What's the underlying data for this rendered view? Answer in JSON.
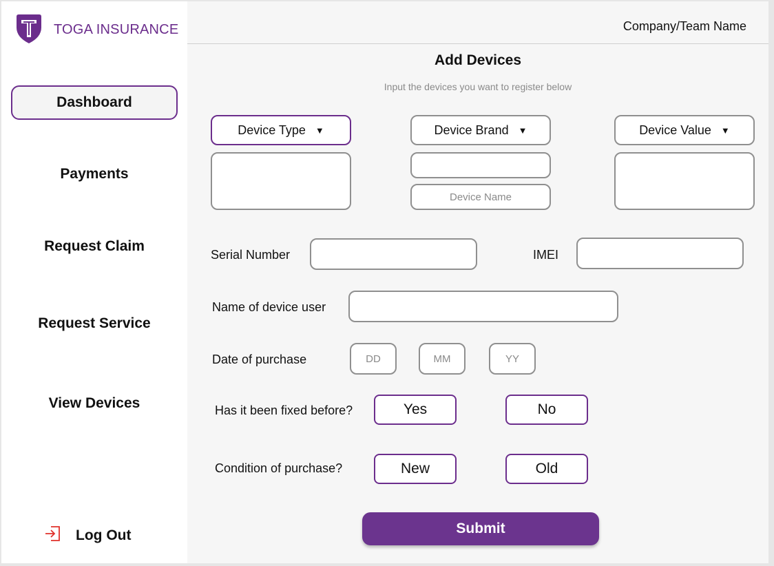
{
  "brand": {
    "name": "TOGA INSURANCE",
    "logo_letter": "T",
    "color": "#6b2d8c"
  },
  "sidebar": {
    "items": [
      {
        "label": "Dashboard",
        "active": true
      },
      {
        "label": "Payments"
      },
      {
        "label": "Request Claim"
      },
      {
        "label": "Request Service"
      },
      {
        "label": "View Devices"
      }
    ],
    "logout": {
      "label": "Log Out",
      "icon": "logout-icon"
    }
  },
  "header": {
    "team_name": "Company/Team Name"
  },
  "form": {
    "title": "Add Devices",
    "subtitle": "Input the devices you want to register below",
    "device_type": {
      "label": "Device Type",
      "caret": "▼"
    },
    "device_brand": {
      "label": "Device Brand",
      "caret": "▼"
    },
    "device_value": {
      "label": "Device Value",
      "caret": "▼"
    },
    "device_name_placeholder": "Device Name",
    "serial_label": "Serial Number",
    "imei_label": "IMEI",
    "user_label": "Name of device user",
    "date_label": "Date of purchase",
    "date": {
      "dd": "DD",
      "mm": "MM",
      "yy": "YY"
    },
    "fixed_label": "Has it been fixed before?",
    "fixed_options": {
      "yes": "Yes",
      "no": "No"
    },
    "condition_label": "Condition of purchase?",
    "condition_options": {
      "new": "New",
      "old": "Old"
    },
    "submit_label": "Submit"
  }
}
